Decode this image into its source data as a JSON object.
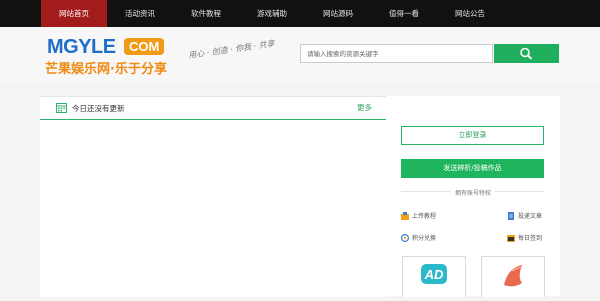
{
  "nav": {
    "items": [
      {
        "label": "网站首页",
        "active": true
      },
      {
        "label": "活动资讯"
      },
      {
        "label": "软件教程"
      },
      {
        "label": "游戏辅助"
      },
      {
        "label": "网站源码"
      },
      {
        "label": "值得一看"
      },
      {
        "label": "网站公告"
      }
    ]
  },
  "header": {
    "logo_main": "MGYLE",
    "logo_com": "COM",
    "logo_sub": "芒果娱乐网·乐于分享",
    "slogan": "用心 · 创造 · 你我 · 共享",
    "search_placeholder": "请输入搜索的资源关键字"
  },
  "main": {
    "panel_title": "今日还没有更新",
    "more_label": "更多"
  },
  "sidebar": {
    "login_label": "立即登录",
    "post_label": "发送辨析/投稿作品",
    "privilege_title": "拥有账号特权",
    "privileges": [
      {
        "label": "上传教程",
        "icon": "upload-icon"
      },
      {
        "label": "投递文章",
        "icon": "document-icon"
      },
      {
        "label": "积分兑换",
        "icon": "points-icon"
      },
      {
        "label": "每日签到",
        "icon": "calendar-icon"
      }
    ],
    "cards": [
      {
        "icon": "ad-icon",
        "text": "AD"
      },
      {
        "icon": "shoe-icon"
      }
    ]
  },
  "colors": {
    "accent_green": "#1fb45e",
    "nav_active": "#a31c1c",
    "logo_blue": "#1f6fc9",
    "logo_orange": "#f19a16"
  }
}
